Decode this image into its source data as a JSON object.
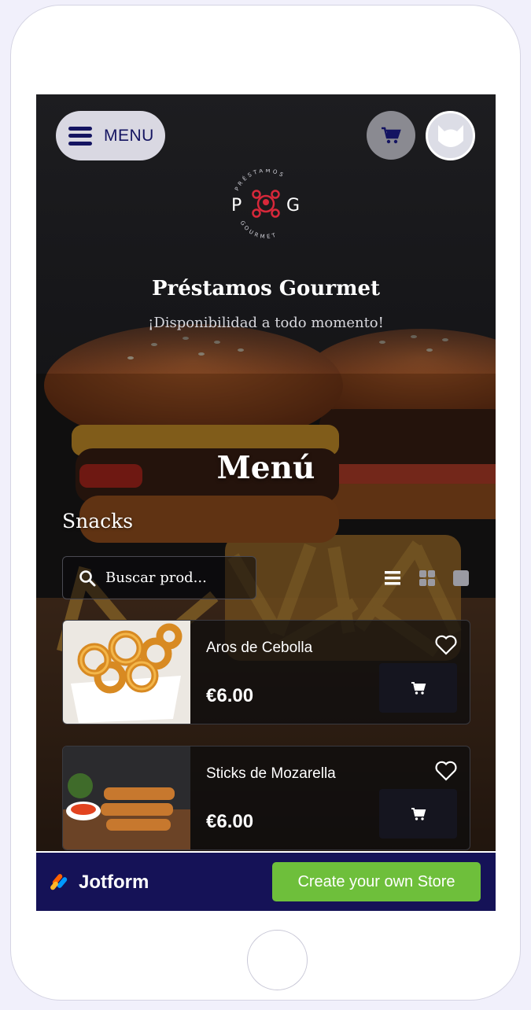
{
  "header": {
    "menu_label": "MENU",
    "brand_title": "Préstamos Gourmet",
    "brand_subtitle": "¡Disponibilidad a todo momento!",
    "logo_text": {
      "left": "P",
      "right": "G",
      "top_arc": "PRÉSTAMOS",
      "bottom_arc": "GOURMET"
    }
  },
  "main": {
    "title": "Menú",
    "category": "Snacks",
    "search_placeholder": "Buscar prod...",
    "view_modes": [
      "list-view-icon",
      "grid-view-icon",
      "single-view-icon"
    ]
  },
  "products": [
    {
      "name": "Aros de Cebolla",
      "price": "€6.00"
    },
    {
      "name": "Sticks de Mozarella",
      "price": "€6.00"
    }
  ],
  "footer": {
    "brand": "Jotform",
    "cta": "Create your own Store"
  },
  "colors": {
    "menu_button_bg": "#d9d8e2",
    "menu_text": "#141461",
    "footer_bg": "#151257",
    "cta_green": "#6ebf3b",
    "logo_red": "#d7283a"
  }
}
